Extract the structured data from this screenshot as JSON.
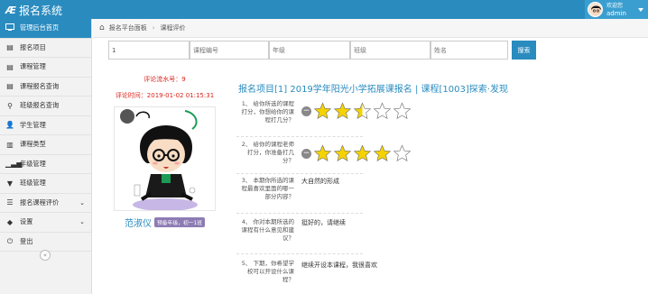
{
  "app": {
    "title": "报名系统"
  },
  "user": {
    "welcome": "欢迎您",
    "name": "admin"
  },
  "sidebar": {
    "items": [
      {
        "label": "管理后台首页",
        "icon": "dashboard-icon",
        "active": true
      },
      {
        "label": "报名项目",
        "icon": "doc-icon"
      },
      {
        "label": "课程管理",
        "icon": "doc-icon"
      },
      {
        "label": "课程报名查询",
        "icon": "doc-icon"
      },
      {
        "label": "班级报名查询",
        "icon": "search-icon"
      },
      {
        "label": "学生管理",
        "icon": "user-icon"
      },
      {
        "label": "课程类型",
        "icon": "book-icon"
      },
      {
        "label": "年级管理",
        "icon": "signal-icon"
      },
      {
        "label": "班级管理",
        "icon": "filter-icon"
      },
      {
        "label": "报名课程评价",
        "icon": "list-icon",
        "chevron": "⌄"
      },
      {
        "label": "设置",
        "icon": "tag-icon",
        "chevron": "⌄"
      },
      {
        "label": "登出",
        "icon": "power-icon"
      }
    ],
    "collapse_label": "«"
  },
  "breadcrumb": {
    "home": "报名平台面板",
    "current": "课程评价"
  },
  "search": {
    "field1": "1",
    "placeholder2": "课程编号",
    "placeholder3": "年级",
    "placeholder4": "班级",
    "placeholder5": "姓名",
    "button": "搜索"
  },
  "student": {
    "serial": "评论流水号：9",
    "time": "评论时间：2019-01-02 01:15:31",
    "name": "范淑仪",
    "grade": "预备年级，初一1班"
  },
  "evaluation": {
    "title": "报名项目[1] 2019学年阳光小学拓展课报名 | 课程[1003]探索·发现",
    "q1": {
      "text": "1、 给你所选的课程打分，你想给你的课程打几分？",
      "rating": 2.5,
      "max": 5
    },
    "q2": {
      "text": "2、 给你的课程老师打分，你准备打几分？",
      "rating": 4,
      "max": 5
    },
    "q3": {
      "text": "3、 本期你所选的课程最喜欢里面的哪一部分内容？",
      "answer": "大自然的形成"
    },
    "q4": {
      "text": "4、 你对本期所选的课程有什么意见和建议？",
      "answer": "挺好的，请继续"
    },
    "q5": {
      "text": "5、 下期，你希望学校可以开设什么课程？",
      "answer": "继续开设本课程，我很喜欢"
    }
  },
  "colors": {
    "primary": "#2a8bbf",
    "alert": "#d9241c",
    "star": "#f5d200"
  }
}
